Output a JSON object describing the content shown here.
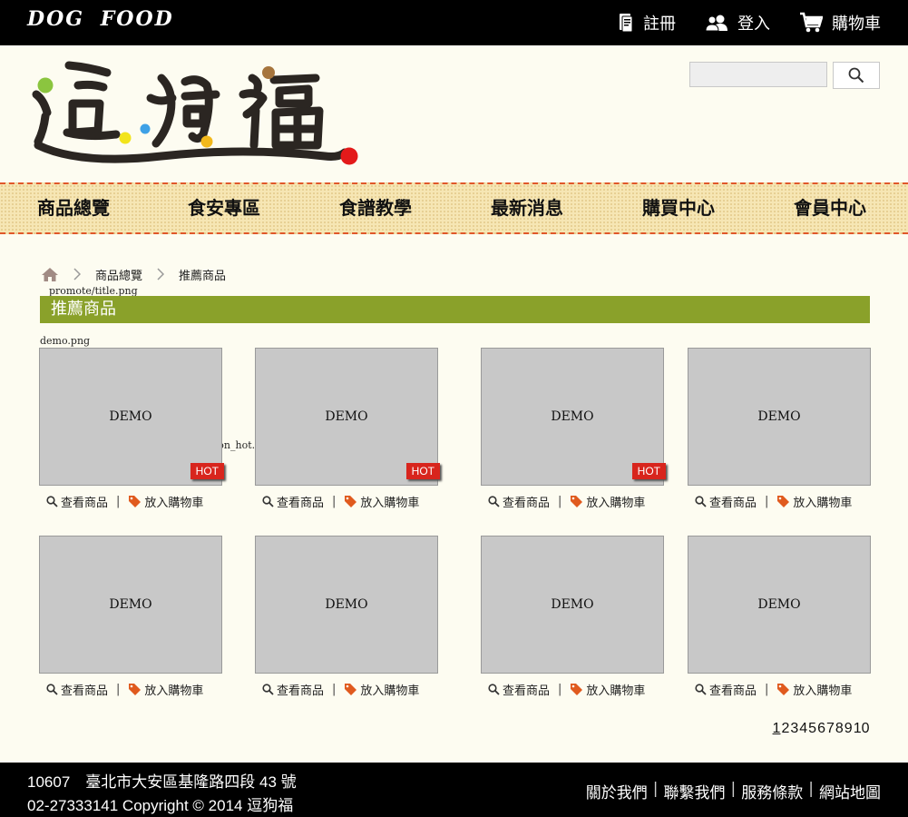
{
  "topbar": {
    "brand": "DOG FOOD",
    "links": [
      {
        "label": "註冊",
        "icon": "register-icon"
      },
      {
        "label": "登入",
        "icon": "users-icon"
      },
      {
        "label": "購物車",
        "icon": "cart-icon"
      }
    ]
  },
  "search": {
    "placeholder": ""
  },
  "nav": [
    "商品總覽",
    "食安專區",
    "食譜教學",
    "最新消息",
    "購買中心",
    "會員中心"
  ],
  "breadcrumb": {
    "items": [
      "商品總覽",
      "推薦商品"
    ]
  },
  "captions": {
    "title_img": "promote/title.png",
    "demo_img": "demo.png",
    "hot_img": "promote/icon_hot.gif"
  },
  "section_title": "推薦商品",
  "products": [
    {
      "label": "DEMO",
      "hot": "HOT",
      "view": "查看商品",
      "cart": "放入購物車"
    },
    {
      "label": "DEMO",
      "hot": "HOT",
      "view": "查看商品",
      "cart": "放入購物車"
    },
    {
      "label": "DEMO",
      "hot": "HOT",
      "view": "查看商品",
      "cart": "放入購物車"
    },
    {
      "label": "DEMO",
      "hot": "",
      "view": "查看商品",
      "cart": "放入購物車"
    },
    {
      "label": "DEMO",
      "hot": "",
      "view": "查看商品",
      "cart": "放入購物車"
    },
    {
      "label": "DEMO",
      "hot": "",
      "view": "查看商品",
      "cart": "放入購物車"
    },
    {
      "label": "DEMO",
      "hot": "",
      "view": "查看商品",
      "cart": "放入購物車"
    },
    {
      "label": "DEMO",
      "hot": "",
      "view": "查看商品",
      "cart": "放入購物車"
    }
  ],
  "pagination": {
    "pages": [
      "1",
      "2",
      "3",
      "4",
      "5",
      "6",
      "7",
      "8",
      "9",
      "10"
    ],
    "current": "1"
  },
  "footer": {
    "address": "10607　臺北市大安區基隆路四段 43 號",
    "copyright": "02-27333141  Copyright © 2014 逗狗福",
    "links": [
      "關於我們",
      "聯繫我們",
      "服務條款",
      "網站地圖"
    ]
  },
  "colors": {
    "accent": "#8aa12a",
    "hot": "#d8251d",
    "nav_border": "#e0572a",
    "tag": "#e05a1e"
  }
}
